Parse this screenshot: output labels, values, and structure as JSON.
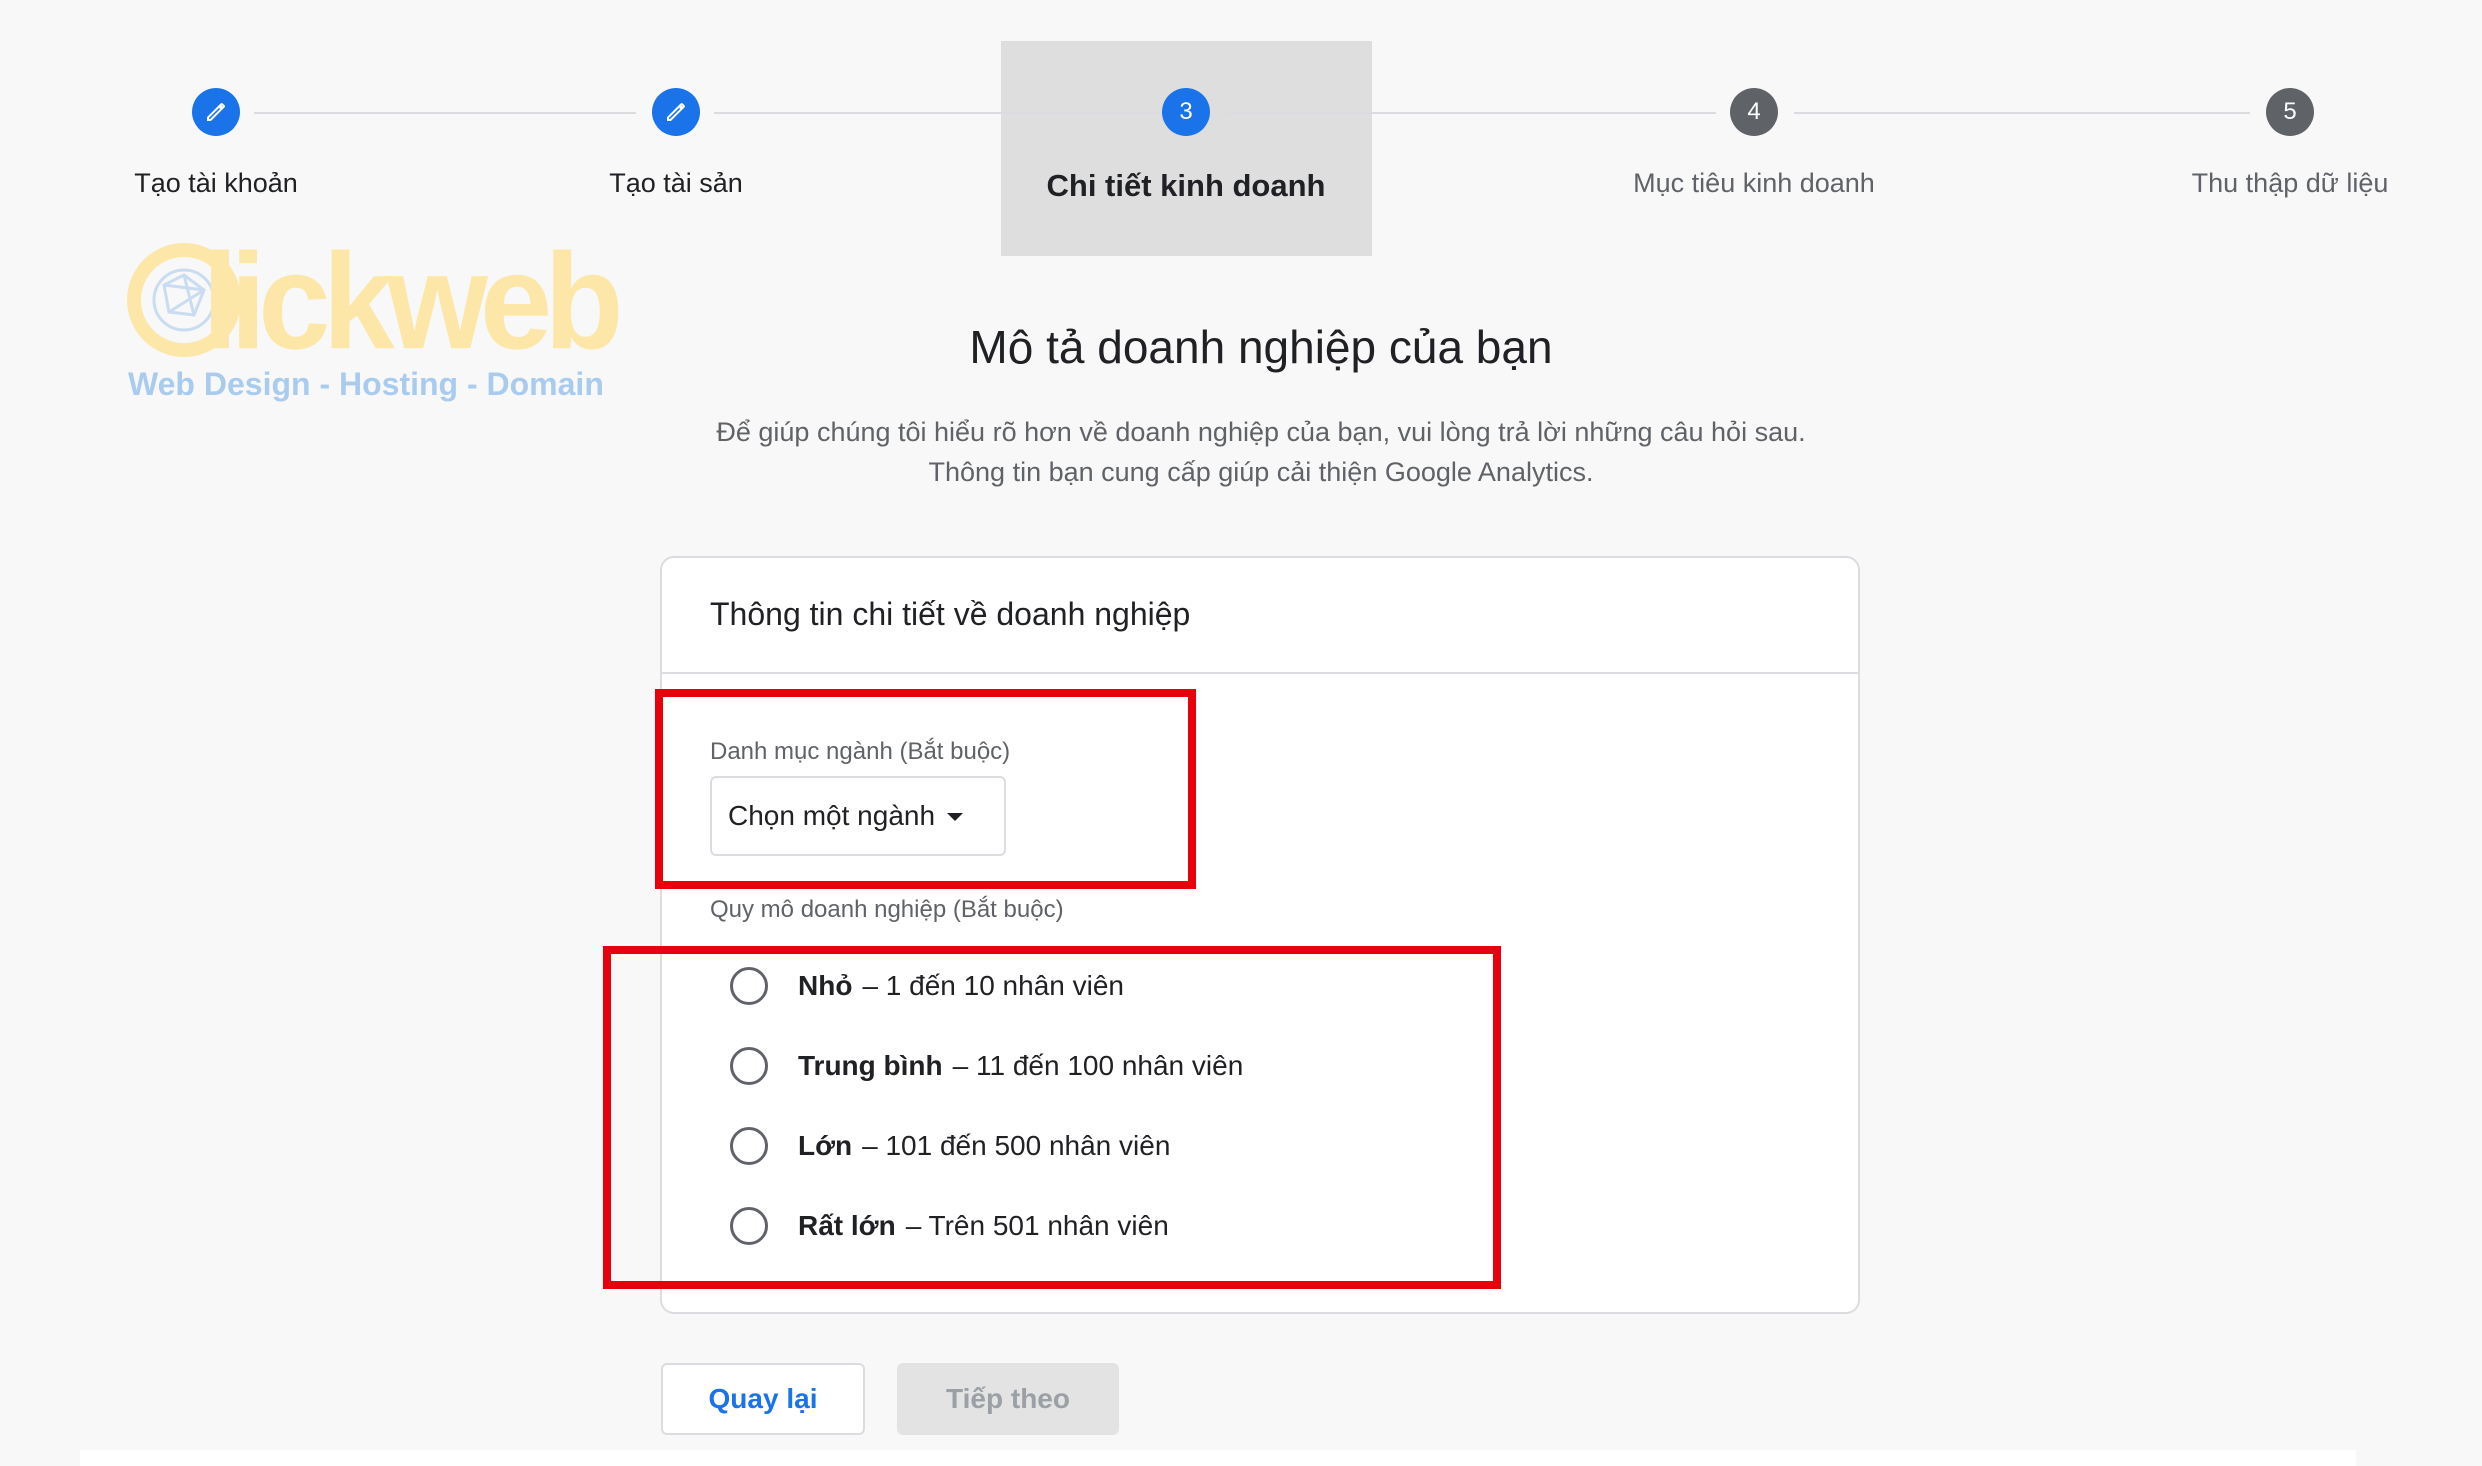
{
  "stepper": {
    "steps": [
      {
        "number": "",
        "label": "Tạo tài khoản",
        "state": "done",
        "icon": "pencil-icon"
      },
      {
        "number": "",
        "label": "Tạo tài sản",
        "state": "done",
        "icon": "pencil-icon"
      },
      {
        "number": "3",
        "label": "Chi tiết kinh doanh",
        "state": "active"
      },
      {
        "number": "4",
        "label": "Mục tiêu kinh doanh",
        "state": "pending"
      },
      {
        "number": "5",
        "label": "Thu thập dữ liệu",
        "state": "pending"
      }
    ]
  },
  "logo": {
    "word": "Clickweb",
    "tagline": "Web Design - Hosting - Domain"
  },
  "page": {
    "heading": "Mô tả doanh nghiệp của bạn",
    "subtitle_line1": "Để giúp chúng tôi hiểu rõ hơn về doanh nghiệp của bạn, vui lòng trả lời những câu hỏi sau.",
    "subtitle_line2": "Thông tin bạn cung cấp giúp cải thiện Google Analytics."
  },
  "card": {
    "title": "Thông tin chi tiết về doanh nghiệp",
    "industry": {
      "label": "Danh mục ngành (Bắt buộc)",
      "select_value": "Chọn một ngành"
    },
    "size": {
      "label": "Quy mô doanh nghiệp (Bắt buộc)",
      "options": [
        {
          "name": "Nhỏ",
          "detail": "– 1 đến 10 nhân viên",
          "selected": false
        },
        {
          "name": "Trung bình",
          "detail": "– 11 đến 100 nhân viên",
          "selected": false
        },
        {
          "name": "Lớn",
          "detail": "– 101 đến 500 nhân viên",
          "selected": false
        },
        {
          "name": "Rất lớn",
          "detail": "– Trên 501 nhân viên",
          "selected": false
        }
      ]
    }
  },
  "buttons": {
    "back_label": "Quay lại",
    "next_label": "Tiếp theo"
  },
  "colors": {
    "accent": "#1a73e8",
    "highlight": "#e8000b",
    "pending_step": "#5f6368"
  }
}
